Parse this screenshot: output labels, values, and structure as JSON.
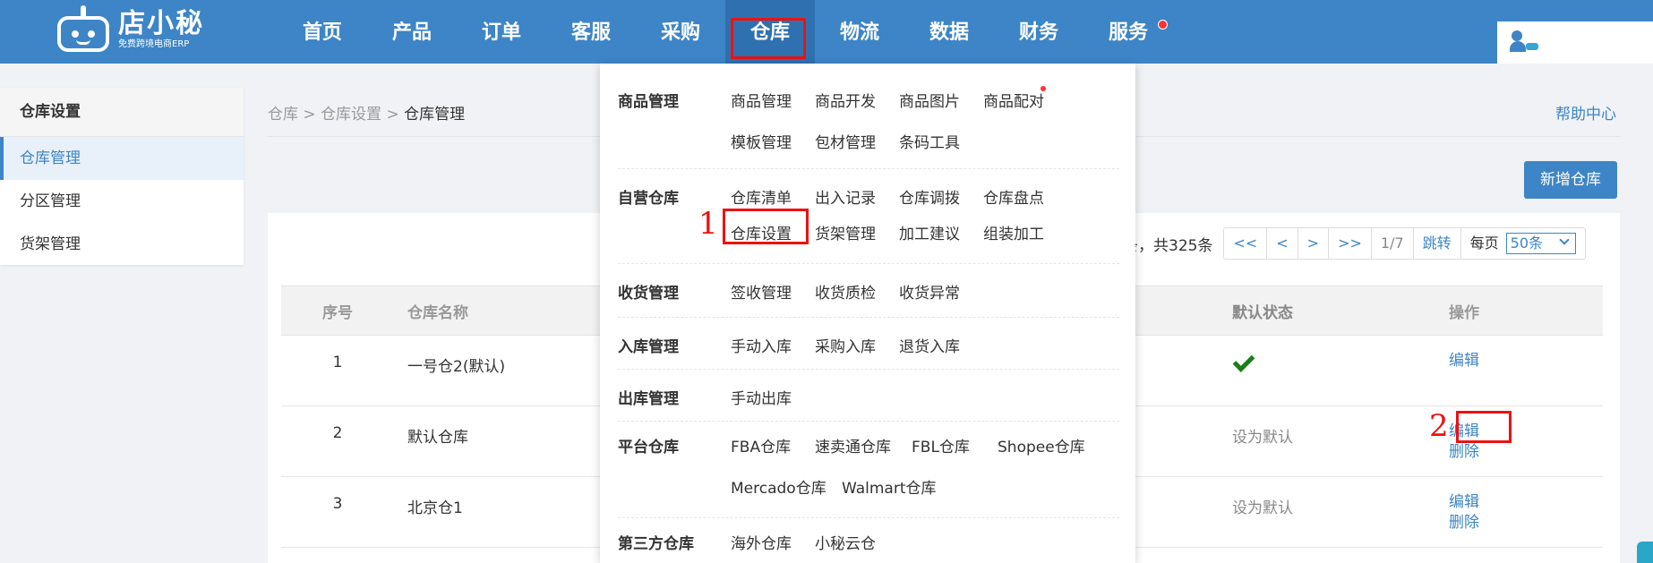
{
  "brand": {
    "name": "店小秘",
    "tagline": "免费跨境电商ERP"
  },
  "nav": [
    {
      "label": "首页"
    },
    {
      "label": "产品"
    },
    {
      "label": "订单"
    },
    {
      "label": "客服"
    },
    {
      "label": "采购"
    },
    {
      "label": "仓库",
      "active": true
    },
    {
      "label": "物流"
    },
    {
      "label": "数据"
    },
    {
      "label": "财务"
    },
    {
      "label": "服务",
      "dot": true
    }
  ],
  "sidebar": {
    "title": "仓库设置",
    "items": [
      {
        "label": "仓库管理",
        "active": true
      },
      {
        "label": "分区管理"
      },
      {
        "label": "货架管理"
      }
    ]
  },
  "breadcrumb": {
    "a": "仓库",
    "sep": ">",
    "b": "仓库设置",
    "c": "仓库管理"
  },
  "help_label": "帮助中心",
  "add_button": "新增仓库",
  "pager": {
    "summary": "条，共325条",
    "first": "<<",
    "prev": "<",
    "next": ">",
    "last": ">>",
    "page": "1/7",
    "jump": "跳转",
    "per_page_label": "每页",
    "per_page_value": "50条"
  },
  "table": {
    "headers": {
      "idx": "序号",
      "name": "仓库名称",
      "default": "默认状态",
      "op": "操作"
    },
    "rows": [
      {
        "idx": "1",
        "name": "一号仓2(默认)",
        "default": "",
        "is_default": true,
        "ops": [
          "编辑"
        ]
      },
      {
        "idx": "2",
        "name": "默认仓库",
        "default": "设为默认",
        "ops": [
          "编辑",
          "删除"
        ]
      },
      {
        "idx": "3",
        "name": "北京仓1",
        "default": "设为默认",
        "ops": [
          "编辑",
          "删除"
        ]
      }
    ]
  },
  "dropdown": {
    "sections": [
      {
        "title": "商品管理",
        "links": [
          "商品管理",
          "商品开发",
          "商品图片",
          "商品配对",
          "模板管理",
          "包材管理",
          "条码工具"
        ]
      },
      {
        "title": "自营仓库",
        "links": [
          "仓库清单",
          "出入记录",
          "仓库调拨",
          "仓库盘点",
          "仓库设置",
          "货架管理",
          "加工建议",
          "组装加工"
        ]
      },
      {
        "title": "收货管理",
        "links": [
          "签收管理",
          "收货质检",
          "收货异常"
        ]
      },
      {
        "title": "入库管理",
        "links": [
          "手动入库",
          "采购入库",
          "退货入库"
        ]
      },
      {
        "title": "出库管理",
        "links": [
          "手动出库"
        ]
      },
      {
        "title": "平台仓库",
        "links": [
          "FBA仓库",
          "速卖通仓库",
          "FBL仓库",
          "Shopee仓库",
          "Mercado仓库",
          "Walmart仓库"
        ]
      },
      {
        "title": "第三方仓库",
        "links": [
          "海外仓库",
          "小秘云仓"
        ]
      }
    ]
  },
  "annotations": {
    "step1": "1",
    "step2": "2"
  },
  "colors": {
    "primary": "#3d85c6",
    "highlight": "#e11111",
    "check": "#1a7f1a"
  }
}
